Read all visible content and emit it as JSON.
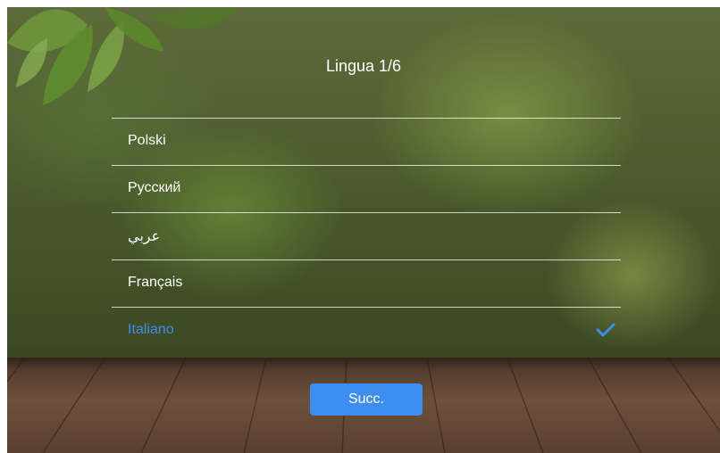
{
  "header": {
    "title": "Lingua 1/6"
  },
  "language_list": {
    "items": [
      {
        "label": "Polski",
        "selected": false
      },
      {
        "label": "Русский",
        "selected": false
      },
      {
        "label": "عربي",
        "selected": false
      },
      {
        "label": "Français",
        "selected": false
      },
      {
        "label": "Italiano",
        "selected": true
      }
    ],
    "selected_icon": "checkmark-icon"
  },
  "footer": {
    "next_label": "Succ."
  },
  "colors": {
    "accent": "#3d8ef0",
    "text": "#ffffff",
    "divider": "#ffffff"
  }
}
